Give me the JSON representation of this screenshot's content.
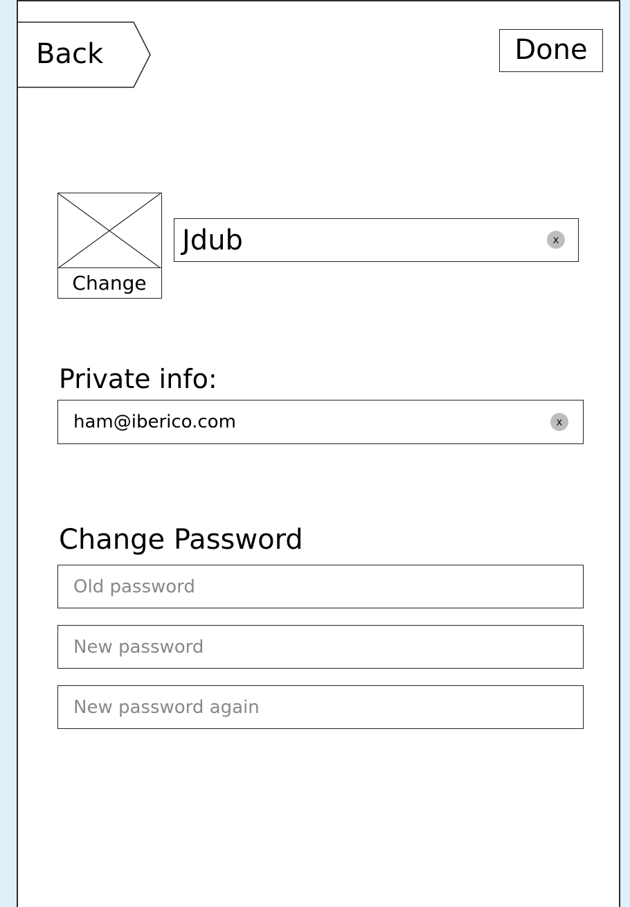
{
  "header": {
    "back_label": "Back",
    "done_label": "Done"
  },
  "profile": {
    "change_photo_label": "Change",
    "username_value": "Jdub",
    "clear_icon_label": "x"
  },
  "private_info": {
    "title": "Private info:",
    "email_value": "ham@iberico.com",
    "clear_icon_label": "x"
  },
  "change_password": {
    "title": "Change Password",
    "old_placeholder": "Old password",
    "new_placeholder": "New password",
    "confirm_placeholder": "New password again"
  },
  "colors": {
    "background": "#dff0f8",
    "screen": "#ffffff",
    "border": "#222222",
    "clear_icon": "#bdbdbd",
    "placeholder": "#888888"
  }
}
